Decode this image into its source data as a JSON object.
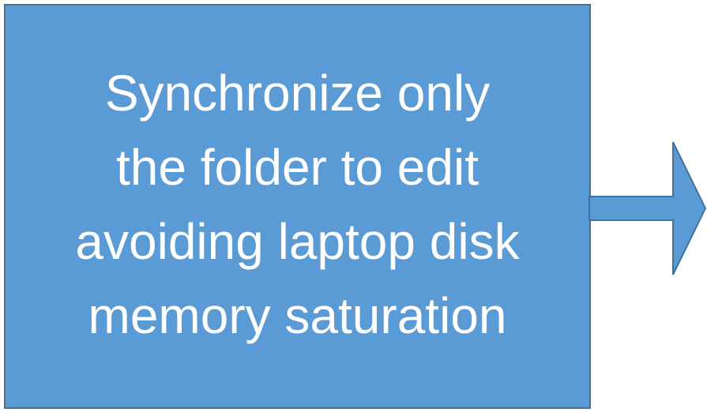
{
  "box": {
    "lines": [
      "Synchronize only",
      "the folder to edit",
      "avoiding laptop disk",
      "memory saturation"
    ],
    "fill_color": "#5b9bd5",
    "border_color": "#41719c",
    "text_color": "#ffffff"
  },
  "arrow": {
    "icon": "right-arrow-icon",
    "fill_color": "#5b9bd5",
    "border_color": "#41719c"
  }
}
